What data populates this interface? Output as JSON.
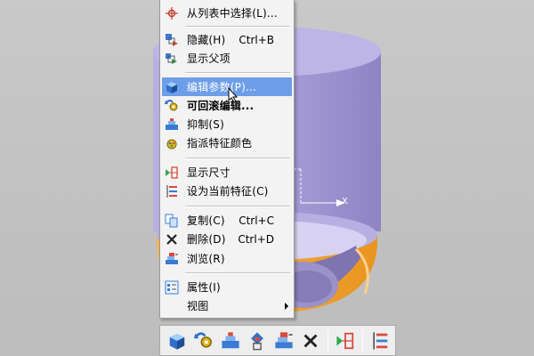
{
  "menu": {
    "items": [
      {
        "label": "从列表中选择(L)...",
        "shortcut": "",
        "icon": "crosshair-icon"
      },
      {
        "label": "隐藏(H)",
        "shortcut": "Ctrl+B",
        "icon": "hide-icon"
      },
      {
        "label": "显示父项",
        "shortcut": "",
        "icon": "show-parent-icon"
      },
      {
        "label": "编辑参数(P)...",
        "shortcut": "",
        "icon": "edit-parameters-icon"
      },
      {
        "label": "可回滚编辑...",
        "shortcut": "",
        "icon": "rollback-edit-icon"
      },
      {
        "label": "抑制(S)",
        "shortcut": "",
        "icon": "suppress-icon"
      },
      {
        "label": "指派特征颜色",
        "shortcut": "",
        "icon": "feature-color-icon"
      },
      {
        "label": "显示尺寸",
        "shortcut": "",
        "icon": "show-dimensions-icon"
      },
      {
        "label": "设为当前特征(C)",
        "shortcut": "",
        "icon": "make-current-feature-icon"
      },
      {
        "label": "复制(C)",
        "shortcut": "Ctrl+C",
        "icon": "copy-icon"
      },
      {
        "label": "删除(D)",
        "shortcut": "Ctrl+D",
        "icon": "delete-icon"
      },
      {
        "label": "浏览(R)",
        "shortcut": "",
        "icon": "browse-icon"
      },
      {
        "label": "属性(I)",
        "shortcut": "",
        "icon": "properties-icon"
      },
      {
        "label": "视图",
        "shortcut": "",
        "icon": ""
      }
    ]
  },
  "toolbar": {
    "icons": [
      "edit-parameters-icon",
      "rollback-edit-icon",
      "suppress-icon",
      "hide-icon",
      "browse-icon",
      "delete-icon",
      "show-dimensions-icon",
      "make-current-feature-icon"
    ]
  },
  "viewport": {
    "axis_label": "X",
    "colors": {
      "body": "#a99fd6",
      "ring": "#f0a030",
      "bg": "#c4c4c4",
      "highlight": "#6f9ee8"
    }
  }
}
